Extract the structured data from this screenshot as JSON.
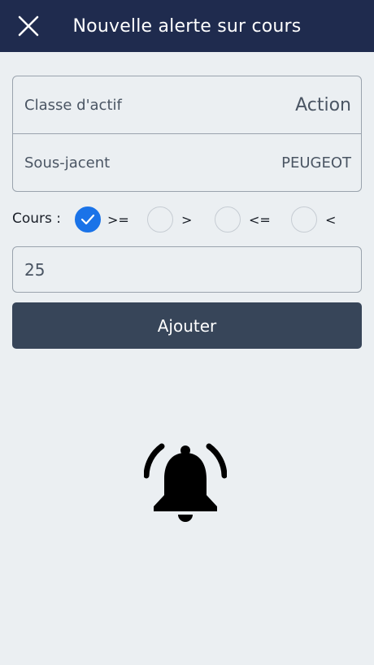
{
  "header": {
    "title": "Nouvelle alerte sur cours",
    "close_icon": "close-icon"
  },
  "asset_card": {
    "asset_class_label": "Classe d'actif",
    "asset_class_value": "Action",
    "underlying_label": "Sous-jacent",
    "underlying_value": "PEUGEOT"
  },
  "cours": {
    "label": "Cours :",
    "options": [
      {
        "op": ">=",
        "selected": true
      },
      {
        "op": ">",
        "selected": false
      },
      {
        "op": "<=",
        "selected": false
      },
      {
        "op": "<",
        "selected": false
      }
    ]
  },
  "price_input": {
    "value": "25"
  },
  "add_button": {
    "label": "Ajouter"
  },
  "illustration": {
    "icon": "bell-ringing-icon"
  },
  "colors": {
    "header_bg": "#1f2b4e",
    "accent": "#1a73e8",
    "button_bg": "#374559",
    "page_bg": "#ebeff2"
  }
}
